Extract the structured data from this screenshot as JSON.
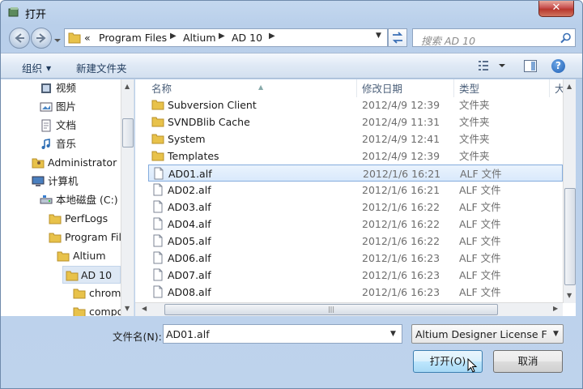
{
  "window": {
    "title": "打开",
    "close_label": "✕"
  },
  "address": {
    "overflow": "«",
    "path": [
      "Program Files",
      "Altium",
      "AD 10"
    ]
  },
  "search": {
    "placeholder": "搜索 AD 10"
  },
  "toolbar": {
    "organize_label": "组织",
    "new_folder_label": "新建文件夹",
    "help_label": "?"
  },
  "nav": {
    "items": [
      {
        "label": "视频",
        "icon": "video-library-icon"
      },
      {
        "label": "图片",
        "icon": "pictures-library-icon"
      },
      {
        "label": "文档",
        "icon": "documents-library-icon"
      },
      {
        "label": "音乐",
        "icon": "music-library-icon"
      },
      {
        "label": "Administrator",
        "icon": "user-folder-icon"
      },
      {
        "label": "计算机",
        "icon": "computer-icon"
      },
      {
        "label": "本地磁盘 (C:)",
        "icon": "drive-icon"
      },
      {
        "label": "PerfLogs",
        "icon": "folder-icon"
      },
      {
        "label": "Program Files",
        "icon": "folder-icon"
      },
      {
        "label": "Altium",
        "icon": "folder-icon"
      },
      {
        "label": "AD 10",
        "icon": "folder-icon",
        "selected": true
      },
      {
        "label": "chrome",
        "icon": "folder-icon"
      },
      {
        "label": "compo",
        "icon": "folder-icon"
      }
    ]
  },
  "columns": {
    "name": "名称",
    "modified": "修改日期",
    "type": "类型",
    "size": "大"
  },
  "files": [
    {
      "name": "Subversion Client",
      "modified": "2012/4/9 12:39",
      "type": "文件夹",
      "kind": "folder"
    },
    {
      "name": "SVNDBlib Cache",
      "modified": "2012/4/9 11:31",
      "type": "文件夹",
      "kind": "folder"
    },
    {
      "name": "System",
      "modified": "2012/4/9 12:41",
      "type": "文件夹",
      "kind": "folder"
    },
    {
      "name": "Templates",
      "modified": "2012/4/9 12:39",
      "type": "文件夹",
      "kind": "folder"
    },
    {
      "name": "AD01.alf",
      "modified": "2012/1/6 16:21",
      "type": "ALF 文件",
      "kind": "file",
      "selected": true
    },
    {
      "name": "AD02.alf",
      "modified": "2012/1/6 16:21",
      "type": "ALF 文件",
      "kind": "file"
    },
    {
      "name": "AD03.alf",
      "modified": "2012/1/6 16:22",
      "type": "ALF 文件",
      "kind": "file"
    },
    {
      "name": "AD04.alf",
      "modified": "2012/1/6 16:22",
      "type": "ALF 文件",
      "kind": "file"
    },
    {
      "name": "AD05.alf",
      "modified": "2012/1/6 16:22",
      "type": "ALF 文件",
      "kind": "file"
    },
    {
      "name": "AD06.alf",
      "modified": "2012/1/6 16:23",
      "type": "ALF 文件",
      "kind": "file"
    },
    {
      "name": "AD07.alf",
      "modified": "2012/1/6 16:23",
      "type": "ALF 文件",
      "kind": "file"
    },
    {
      "name": "AD08.alf",
      "modified": "2012/1/6 16:23",
      "type": "ALF 文件",
      "kind": "file"
    }
  ],
  "footer": {
    "filename_label": "文件名(N):",
    "filename_value": "AD01.alf",
    "filetype_value": "Altium Designer License Files",
    "open_label": "打开(O)",
    "cancel_label": "取消"
  },
  "colors": {
    "selection_fill": "#d9e9fc",
    "selection_border": "#84acdd",
    "folder": "#e8c24a"
  }
}
